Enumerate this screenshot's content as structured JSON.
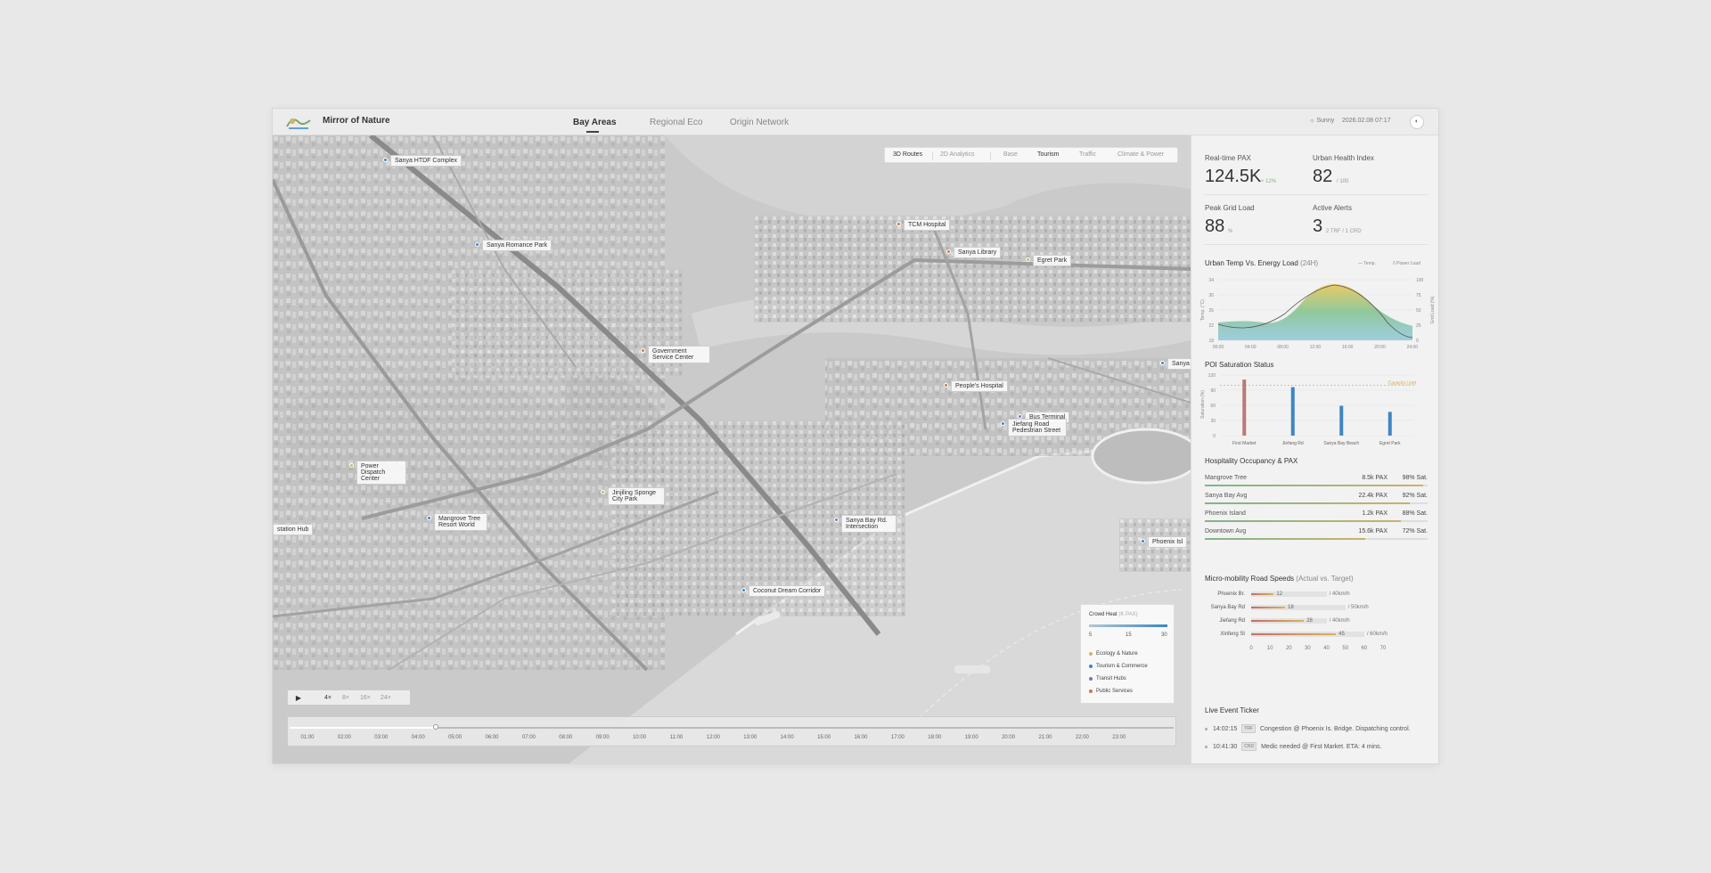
{
  "header": {
    "app_title": "Mirror of Nature",
    "tabs": [
      "Bay Areas",
      "Regional Eco",
      "Origin Network"
    ],
    "active_tab": 0,
    "weather": "☼ Sunny",
    "datetime": "2026.02.08 07:17"
  },
  "map": {
    "modes": [
      "3D Routes",
      "2D Analytics"
    ],
    "layers": [
      "Base",
      "Tourism",
      "Traffic",
      "Climate & Power"
    ],
    "active_mode": "3D Routes",
    "active_layer": "Tourism",
    "pois": [
      {
        "label": "Sanya HTDF Complex",
        "category": "tourism"
      },
      {
        "label": "Sanya Romance Park",
        "category": "tourism"
      },
      {
        "label": "Government Service Center",
        "category": "public"
      },
      {
        "label": "Power Dispatch Center",
        "category": "ecology"
      },
      {
        "label": "Mangrove Tree Resort World",
        "category": "tourism"
      },
      {
        "label": "station Hub",
        "category": "transit"
      },
      {
        "label": "Jinjiling Sponge City Park",
        "category": "ecology"
      },
      {
        "label": "Sanya Bay Rd. Intersection",
        "category": "transit"
      },
      {
        "label": "Coconut Dream Corridor",
        "category": "tourism"
      },
      {
        "label": "TCM Hospital",
        "category": "public"
      },
      {
        "label": "Sanya Library",
        "category": "public"
      },
      {
        "label": "Egret Park",
        "category": "ecology"
      },
      {
        "label": "People's Hospital",
        "category": "public"
      },
      {
        "label": "Bus Terminal",
        "category": "transit"
      },
      {
        "label": "Jiefang Road Pedestrian Street",
        "category": "tourism"
      },
      {
        "label": "Sanya",
        "category": "tourism"
      },
      {
        "label": "Phoenix Isl",
        "category": "tourism"
      }
    ],
    "legend": {
      "title": "Crowd Heat",
      "subtitle": "(K PAX)",
      "ticks": [
        "5",
        "15",
        "30"
      ],
      "items": [
        {
          "label": "Ecology & Nature",
          "color": "#c9b66b"
        },
        {
          "label": "Tourism & Commerce",
          "color": "#3b86c7"
        },
        {
          "label": "Transit Hubs",
          "color": "#8a6fb0"
        },
        {
          "label": "Public Services",
          "color": "#c97a4a"
        }
      ]
    },
    "playback": {
      "play_icon": "play-icon",
      "speeds": [
        "4×",
        "8×",
        "16×",
        "24×"
      ],
      "active_speed": "4×"
    },
    "timeline": {
      "hours": [
        "01:00",
        "02:00",
        "03:00",
        "04:00",
        "05:00",
        "06:00",
        "07:00",
        "08:00",
        "09:00",
        "10:00",
        "11:00",
        "12:00",
        "13:00",
        "14:00",
        "15:00",
        "16:00",
        "17:00",
        "18:00",
        "19:00",
        "20:00",
        "21:00",
        "22:00",
        "23:00"
      ],
      "progress": 0.165
    }
  },
  "kpis": {
    "pax": {
      "label": "Real-time PAX",
      "value": "124.5K",
      "delta": "+ 12%"
    },
    "health": {
      "label": "Urban Health Index",
      "value": "82",
      "unit": "/ 100"
    },
    "grid": {
      "label": "Peak Grid Load",
      "value": "88",
      "unit": "%"
    },
    "alerts": {
      "label": "Active Alerts",
      "value": "3",
      "unit": "2 TRF / 1 CRD"
    }
  },
  "temp_chart": {
    "title": "Urban Temp Vs. Energy Load",
    "title_sub": "(24H)",
    "legend_temp": "— Temp.",
    "legend_load": "/\\ Power Load",
    "y_left_label": "Temp. (°C)",
    "y_right_label": "Grid Load (%)",
    "y_left_ticks": [
      "34",
      "30",
      "26",
      "22",
      "18"
    ],
    "y_right_ticks": [
      "100",
      "75",
      "50",
      "25",
      "0"
    ],
    "x_ticks": [
      "00:00",
      "04:00",
      "08:00",
      "12:00",
      "16:00",
      "20:00",
      "24:00"
    ]
  },
  "chart_data": {
    "type": "bar",
    "title": "POI Saturation Status",
    "ylabel": "Saturation (%)",
    "categories": [
      "First Market",
      "Jiefang Rd",
      "Sanya Bay Beach",
      "Egret Park"
    ],
    "values": [
      111,
      96,
      59,
      47
    ],
    "ylim": [
      0,
      120
    ],
    "y_ticks": [
      "120",
      "90",
      "60",
      "30",
      "0"
    ],
    "reference_line": {
      "label": "Capacity Limit",
      "value": 100
    },
    "bar_colors": [
      "#b97a7a",
      "#3f85c3",
      "#3f85c3",
      "#3f85c3"
    ]
  },
  "hospitality": {
    "title": "Hospitality Occupancy & PAX",
    "rows": [
      {
        "name": "Mangrove Tree",
        "pax": "8.5k PAX",
        "sat": "98% Sat.",
        "fill": 0.98
      },
      {
        "name": "Sanya Bay Avg",
        "pax": "22.4k PAX",
        "sat": "92% Sat.",
        "fill": 0.92
      },
      {
        "name": "Phoenix Island",
        "pax": "1.2k PAX",
        "sat": "88% Sat.",
        "fill": 0.88
      },
      {
        "name": "Downtown Avg",
        "pax": "15.6k PAX",
        "sat": "72% Sat.",
        "fill": 0.72
      }
    ]
  },
  "mobility": {
    "title": "Micro-mobility Road Speeds",
    "title_sub": "(Actual vs. Target)",
    "rows": [
      {
        "name": "Phoenix Br.",
        "actual": 12,
        "target": 40,
        "actual_label": "12",
        "target_label": "/ 40km/h"
      },
      {
        "name": "Sanya Bay Rd",
        "actual": 18,
        "target": 50,
        "actual_label": "18",
        "target_label": "/ 50km/h"
      },
      {
        "name": "Jiefang Rd",
        "actual": 28,
        "target": 40,
        "actual_label": "28",
        "target_label": "/ 40km/h"
      },
      {
        "name": "Xinfeng St",
        "actual": 45,
        "target": 60,
        "actual_label": "45",
        "target_label": "/ 60km/h"
      }
    ],
    "axis": [
      "0",
      "10",
      "20",
      "30",
      "40",
      "50",
      "60",
      "70"
    ]
  },
  "ticker": {
    "title": "Live Event Ticker",
    "events": [
      {
        "time": "14:02:15",
        "tag": "TRF",
        "text": "Congestion @ Phoenix Is. Bridge. Dispatching control."
      },
      {
        "time": "10:41:30",
        "tag": "CRD",
        "text": "Medic needed @ First Market. ETA: 4 mins."
      }
    ]
  }
}
